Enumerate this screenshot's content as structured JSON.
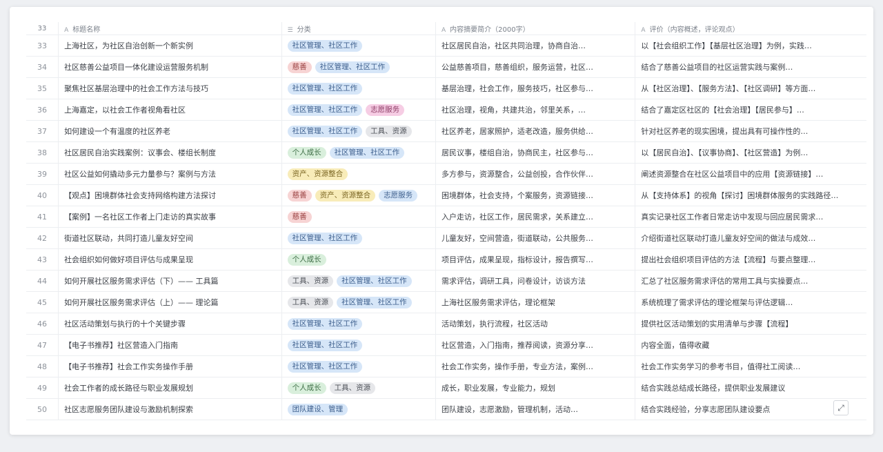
{
  "columns": {
    "num_label": "33",
    "title_label": "标题名称",
    "tags_label": "分类",
    "summary_label": "内容摘要简介（2000字）",
    "review_label": "评价（内容概述，评论观点）"
  },
  "rows": [
    {
      "num": "33",
      "title": "上海社区，为社区自治创新一个新实例",
      "tags": [
        {
          "text": "社区管理、社区工作",
          "color": "blue"
        }
      ],
      "summary": "社区居民自治，社区共同治理，协商自治…",
      "review": "以【社会组织工作】【基层社区治理】为例，实践…"
    },
    {
      "num": "34",
      "title": "社区慈善公益项目一体化建设运营服务机制",
      "tags": [
        {
          "text": "慈善",
          "color": "red"
        },
        {
          "text": "社区管理、社区工作",
          "color": "blue"
        }
      ],
      "summary": "公益慈善项目，慈善组织，服务运营，社区…",
      "review": "结合了慈善公益项目的社区运营实践与案例…"
    },
    {
      "num": "35",
      "title": "聚焦社区基层治理中的社会工作方法与技巧",
      "tags": [
        {
          "text": "社区管理、社区工作",
          "color": "blue"
        }
      ],
      "summary": "基层治理，社会工作，服务技巧，社区参与…",
      "review": "从【社区治理】、【服务方法】、【社区调研】等方面…"
    },
    {
      "num": "36",
      "title": "上海嘉定，以社会工作者视角看社区",
      "tags": [
        {
          "text": "社区管理、社区工作",
          "color": "blue"
        },
        {
          "text": "志愿服务",
          "color": "pink"
        }
      ],
      "summary": "社区治理，视角，共建共治，邻里关系，…",
      "review": "结合了嘉定区社区的【社会治理】【居民参与】…"
    },
    {
      "num": "37",
      "title": "如何建设一个有温度的社区养老",
      "tags": [
        {
          "text": "社区管理、社区工作",
          "color": "blue"
        },
        {
          "text": "工具、资源",
          "color": "gray"
        }
      ],
      "summary": "社区养老，居家照护，适老改造，服务供给…",
      "review": "针对社区养老的现实困境，提出具有可操作性的…"
    },
    {
      "num": "38",
      "title": "社区居民自治实践案例：议事会、楼组长制度",
      "tags": [
        {
          "text": "个人成长",
          "color": "green"
        },
        {
          "text": "社区管理、社区工作",
          "color": "blue"
        }
      ],
      "summary": "居民议事，楼组自治，协商民主，社区参与…",
      "review": "以【居民自治】、【议事协商】、【社区营造】为例…"
    },
    {
      "num": "39",
      "title": "社区公益如何撬动多元力量参与？案例与方法",
      "tags": [
        {
          "text": "资产、资源整合",
          "color": "yellow"
        }
      ],
      "summary": "多方参与，资源整合，公益创投，合作伙伴…",
      "review": "阐述资源整合在社区公益项目中的应用【资源链接】…"
    },
    {
      "num": "40",
      "title": "【观点】困境群体社会支持网络构建方法探讨",
      "tags": [
        {
          "text": "慈善",
          "color": "red"
        },
        {
          "text": "资产、资源整合",
          "color": "yellow"
        },
        {
          "text": "志愿服务",
          "color": "blue"
        }
      ],
      "summary": "困境群体，社会支持，个案服务，资源链接…",
      "review": "从【支持体系】的视角【探讨】困境群体服务的实践路径…"
    },
    {
      "num": "41",
      "title": "【案例】一名社区工作者上门走访的真实故事",
      "tags": [
        {
          "text": "慈善",
          "color": "red"
        }
      ],
      "summary": "入户走访，社区工作，居民需求，关系建立…",
      "review": "真实记录社区工作者日常走访中发现与回应居民需求…"
    },
    {
      "num": "42",
      "title": "街道社区联动，共同打造儿童友好空间",
      "tags": [
        {
          "text": "社区管理、社区工作",
          "color": "blue"
        }
      ],
      "summary": "儿童友好，空间营造，街道联动，公共服务…",
      "review": "介绍街道社区联动打造儿童友好空间的做法与成效…"
    },
    {
      "num": "43",
      "title": "社会组织如何做好项目评估与成果呈现",
      "tags": [
        {
          "text": "个人成长",
          "color": "green"
        }
      ],
      "summary": "项目评估，成果呈现，指标设计，报告撰写…",
      "review": "提出社会组织项目评估的方法【流程】与要点整理…"
    },
    {
      "num": "44",
      "title": "如何开展社区服务需求评估（下）—— 工具篇",
      "tags": [
        {
          "text": "工具、资源",
          "color": "gray"
        },
        {
          "text": "社区管理、社区工作",
          "color": "blue"
        }
      ],
      "summary": "需求评估，调研工具，问卷设计，访谈方法",
      "review": "汇总了社区服务需求评估的常用工具与实操要点…"
    },
    {
      "num": "45",
      "title": "如何开展社区服务需求评估（上）—— 理论篇",
      "tags": [
        {
          "text": "工具、资源",
          "color": "gray"
        },
        {
          "text": "社区管理、社区工作",
          "color": "blue"
        }
      ],
      "summary": "上海社区服务需求评估，理论框架",
      "review": "系统梳理了需求评估的理论框架与评估逻辑…"
    },
    {
      "num": "46",
      "title": "社区活动策划与执行的十个关键步骤",
      "tags": [
        {
          "text": "社区管理、社区工作",
          "color": "blue"
        }
      ],
      "summary": "活动策划，执行流程，社区活动",
      "review": "提供社区活动策划的实用清单与步骤【流程】"
    },
    {
      "num": "47",
      "title": "【电子书推荐】社区营造入门指南",
      "tags": [
        {
          "text": "社区管理、社区工作",
          "color": "blue"
        }
      ],
      "summary": "社区营造，入门指南，推荐阅读，资源分享…",
      "review": "内容全面，值得收藏"
    },
    {
      "num": "48",
      "title": "【电子书推荐】社会工作实务操作手册",
      "tags": [
        {
          "text": "社区管理、社区工作",
          "color": "blue"
        }
      ],
      "summary": "社会工作实务，操作手册，专业方法，案例…",
      "review": "社会工作实务学习的参考书目，值得社工阅读…"
    },
    {
      "num": "49",
      "title": "社会工作者的成长路径与职业发展规划",
      "tags": [
        {
          "text": "个人成长",
          "color": "green"
        },
        {
          "text": "工具、资源",
          "color": "gray"
        }
      ],
      "summary": "成长，职业发展，专业能力，规划",
      "review": "结合实践总结成长路径，提供职业发展建议"
    },
    {
      "num": "50",
      "title": "社区志愿服务团队建设与激励机制探索",
      "tags": [
        {
          "text": "团队建设、管理",
          "color": "blue"
        }
      ],
      "summary": "团队建设，志愿激励，管理机制，活动…",
      "review": "结合实践经验，分享志愿团队建设要点"
    }
  ],
  "expand_icon": "expand-icon",
  "expand_glyph": "⤢"
}
